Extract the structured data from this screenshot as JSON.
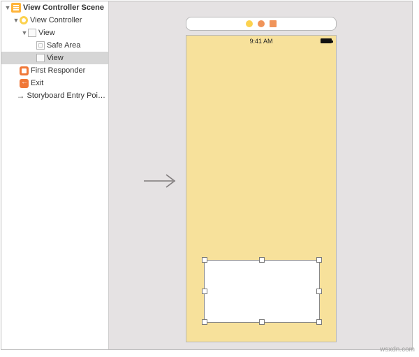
{
  "outline": {
    "scene": "View Controller Scene",
    "vc": "View Controller",
    "root_view": "View",
    "safe_area": "Safe Area",
    "child_view": "View",
    "first_responder": "First Responder",
    "exit": "Exit",
    "entry_point": "Storyboard Entry Poi…"
  },
  "device": {
    "time": "9:41 AM"
  },
  "watermark": "wsxdn.com"
}
